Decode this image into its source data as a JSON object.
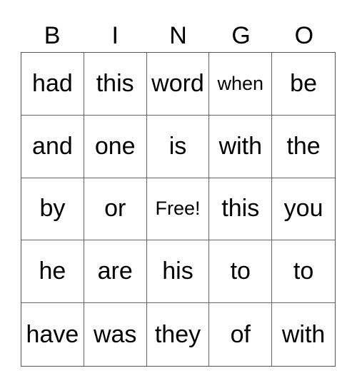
{
  "card": {
    "header": [
      "B",
      "I",
      "N",
      "G",
      "O"
    ],
    "rows": [
      [
        "had",
        "this",
        "word",
        "when",
        "be"
      ],
      [
        "and",
        "one",
        "is",
        "with",
        "the"
      ],
      [
        "by",
        "or",
        "Free!",
        "this",
        "you"
      ],
      [
        "he",
        "are",
        "his",
        "to",
        "to"
      ],
      [
        "have",
        "was",
        "they",
        "of",
        "with"
      ]
    ],
    "free_space_label": "Free!"
  }
}
